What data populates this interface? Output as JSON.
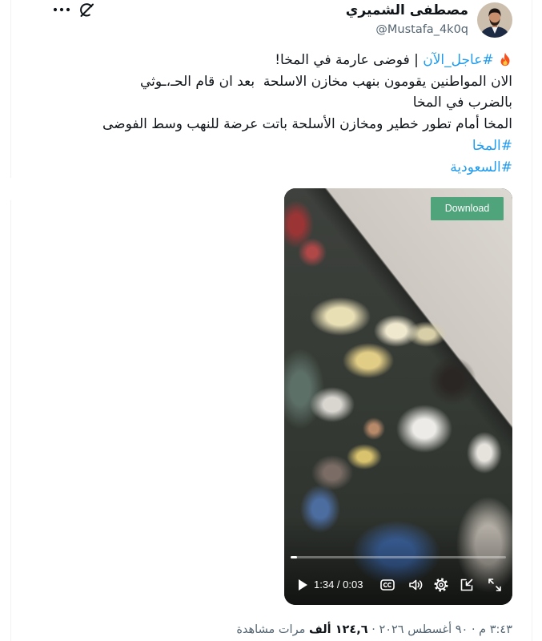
{
  "author": {
    "name": "مصطفى الشميري",
    "handle": "@Mustafa_4k0q"
  },
  "header_icons": {
    "avatar": "avatar",
    "grok": "grok-icon",
    "more": "more-icon"
  },
  "tweet": {
    "line1": {
      "icon": "fire-icon",
      "hashtag": "#عاجل_الآن",
      "text": "| فوضى عارمة في المخا!"
    },
    "line2": "الان المواطنين يقومون بنهب مخازن الاسلحة  بعد ان قام الحـ،ـوثي",
    "line3": "بالضرب في المخا",
    "line4": "المخا أمام تطور خطير ومخازن الأسلحة باتت عرضة للنهب وسط الفوضى",
    "hashtags": [
      "#المخا",
      "#السعودية"
    ]
  },
  "video": {
    "download_label": "Download",
    "time": "1:34 / 0:03",
    "progress": 0.03,
    "control_icons": [
      "play-icon",
      "captions-icon",
      "volume-icon",
      "settings-icon",
      "picture-in-picture-icon",
      "fullscreen-icon"
    ]
  },
  "meta": {
    "time": "٣:٤٣ م",
    "separator": "·",
    "date": "٩٠ أغسطس ٢٠٢٦",
    "views_count": "١٢٤,٦ ألف",
    "views_label": "مرات مشاهدة"
  },
  "colors": {
    "text": "#0f1419",
    "muted": "#536471",
    "link": "#1d9bf0",
    "download": "#4fa47b",
    "border": "#eff3f4"
  }
}
